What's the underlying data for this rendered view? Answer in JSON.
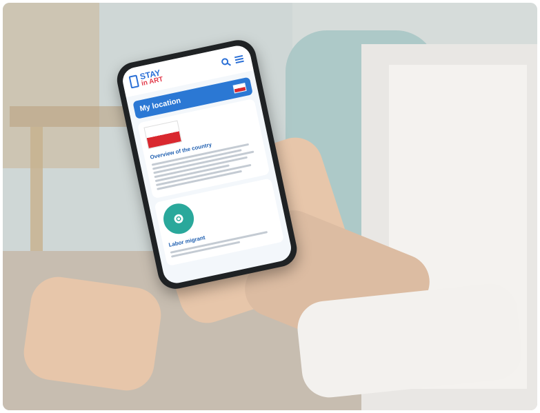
{
  "app": {
    "logo_line1": "STAY",
    "logo_line2": "in ART"
  },
  "location": {
    "title": "My location"
  },
  "card1": {
    "title": "Overview of the country"
  },
  "card2": {
    "title": "Labor migrant"
  },
  "icons": {
    "search": "search-icon",
    "menu": "menu-icon",
    "flag": "poland-flag-icon",
    "gear": "gear-icon"
  },
  "colors": {
    "brand_blue": "#2b78d4",
    "logo_red": "#e23b4b",
    "teal": "#2aa89b"
  }
}
